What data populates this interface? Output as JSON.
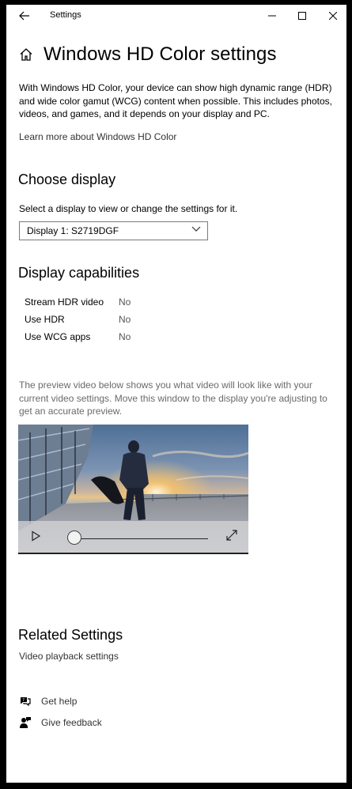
{
  "titlebar": {
    "title": "Settings",
    "icons": [
      "back-arrow-icon",
      "minimize-icon",
      "maximize-icon",
      "close-icon"
    ]
  },
  "header": {
    "icon": "home-icon",
    "title": "Windows HD Color settings"
  },
  "intro": {
    "text": "With Windows HD Color, your device can show high dynamic range (HDR) and wide color gamut (WCG) content when possible. This includes photos, videos, and games, and it depends on your display and PC.",
    "learn_more": "Learn more about Windows HD Color"
  },
  "choose_display": {
    "heading": "Choose display",
    "instruction": "Select a display to view or change the settings for it.",
    "selected": "Display 1: S2719DGF"
  },
  "capabilities": {
    "heading": "Display capabilities",
    "rows": [
      {
        "label": "Stream HDR video",
        "value": "No"
      },
      {
        "label": "Use HDR",
        "value": "No"
      },
      {
        "label": "Use WCG apps",
        "value": "No"
      }
    ]
  },
  "preview": {
    "note": "The preview video below shows you what video will look like with your current video settings. Move this window to the display you're adjusting to get an accurate preview.",
    "progress": 0.05
  },
  "related": {
    "heading": "Related Settings",
    "link": "Video playback settings"
  },
  "help": {
    "get_help": "Get help",
    "give_feedback": "Give feedback"
  },
  "colors": {
    "window_bg": "#ffffff",
    "frame": "#000000",
    "muted_text": "#6a6a6a"
  }
}
